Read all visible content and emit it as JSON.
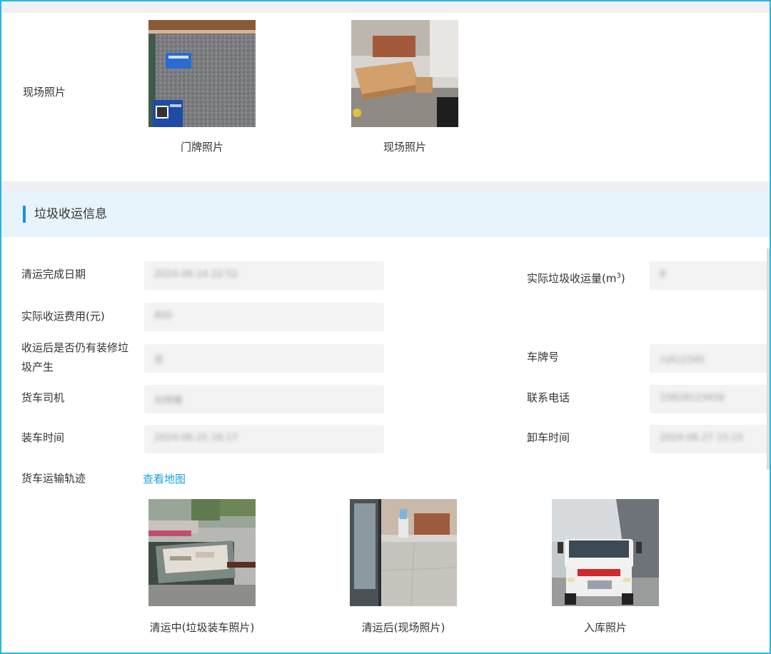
{
  "site_photos": {
    "label": "现场照片",
    "items": [
      {
        "caption": "门牌照片",
        "icon": "doorplate-photo"
      },
      {
        "caption": "现场照片",
        "icon": "site-photo"
      }
    ]
  },
  "section": {
    "title": "垃圾收运信息"
  },
  "fields": {
    "completion_date": {
      "label": "清运完成日期",
      "value": "2024-06-14 22:52"
    },
    "actual_volume": {
      "label": "实际垃圾收运量(m",
      "sup": "3",
      "suffix": ")",
      "value": "8"
    },
    "actual_fee": {
      "label": "实际收运费用(元)",
      "value": "800"
    },
    "still_generating": {
      "label_line1": "收运后是否仍有装修垃",
      "label_line2": "圾产生",
      "value": "否"
    },
    "plate_number": {
      "label": "车牌号",
      "value": "川A12345"
    },
    "driver": {
      "label": "货车司机",
      "value": "刘师傅"
    },
    "phone": {
      "label": "联系电话",
      "value": "15828123456"
    },
    "load_time": {
      "label": "装车时间",
      "value": "2024-06-25 16:17"
    },
    "unload_time": {
      "label": "卸车时间",
      "value": "2024-06-27 15:15"
    }
  },
  "trajectory": {
    "label": "货车运输轨迹",
    "link_text": "查看地图"
  },
  "transport_photos": [
    {
      "caption": "清运中(垃圾装车照片)",
      "icon": "loading-photo"
    },
    {
      "caption": "清运后(现场照片)",
      "icon": "after-photo"
    },
    {
      "caption": "入库照片",
      "icon": "truck-photo"
    }
  ],
  "colors": {
    "accent": "#1a8fe3",
    "link": "#1aa0e6",
    "border": "#29b3e8",
    "header_bg": "#e8f4fb"
  }
}
